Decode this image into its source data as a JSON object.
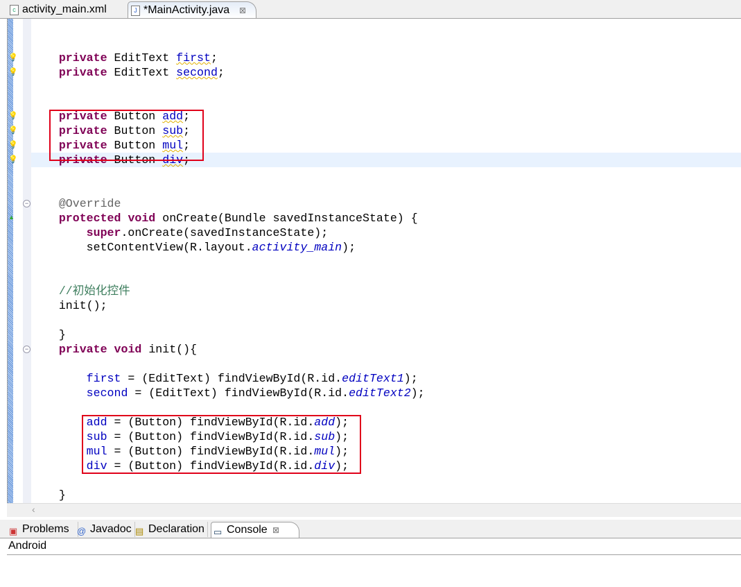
{
  "tabs": [
    {
      "label": "activity_main.xml",
      "icon": "xml-file-icon"
    },
    {
      "label": "*MainActivity.java",
      "icon": "java-file-icon",
      "active": true
    }
  ],
  "code": [
    [],
    [
      [
        "    "
      ],
      [
        "private",
        "kw"
      ],
      [
        " EditText "
      ],
      [
        "first",
        "fld warn"
      ],
      [
        ";"
      ]
    ],
    [
      [
        "    "
      ],
      [
        "private",
        "kw"
      ],
      [
        " EditText "
      ],
      [
        "second",
        "fld warn"
      ],
      [
        ";"
      ]
    ],
    [],
    [],
    [
      [
        "    "
      ],
      [
        "private",
        "kw"
      ],
      [
        " Button "
      ],
      [
        "add",
        "fld warn"
      ],
      [
        ";"
      ]
    ],
    [
      [
        "    "
      ],
      [
        "private",
        "kw"
      ],
      [
        " Button "
      ],
      [
        "sub",
        "fld warn"
      ],
      [
        ";"
      ]
    ],
    [
      [
        "    "
      ],
      [
        "private",
        "kw"
      ],
      [
        " Button "
      ],
      [
        "mul",
        "fld warn"
      ],
      [
        ";"
      ]
    ],
    [
      [
        "    "
      ],
      [
        "private",
        "kw"
      ],
      [
        " Button "
      ],
      [
        "div",
        "fld warn"
      ],
      [
        ";"
      ]
    ],
    [],
    [],
    [
      [
        "    "
      ],
      [
        "@Override",
        "ann"
      ]
    ],
    [
      [
        "    "
      ],
      [
        "protected",
        "kw"
      ],
      [
        " "
      ],
      [
        "void",
        "kw"
      ],
      [
        " onCreate(Bundle savedInstanceState) {"
      ]
    ],
    [
      [
        "        "
      ],
      [
        "super",
        "kw"
      ],
      [
        ".onCreate(savedInstanceState);"
      ]
    ],
    [
      [
        "        setContentView(R.layout."
      ],
      [
        "activity_main",
        "stat"
      ],
      [
        ");"
      ]
    ],
    [],
    [],
    [
      [
        "    "
      ],
      [
        "//初始化控件",
        "cmt"
      ]
    ],
    [
      [
        "    init();"
      ]
    ],
    [],
    [
      [
        "    }"
      ]
    ],
    [
      [
        "    "
      ],
      [
        "private",
        "kw"
      ],
      [
        " "
      ],
      [
        "void",
        "kw"
      ],
      [
        " init(){"
      ]
    ],
    [],
    [
      [
        "        "
      ],
      [
        "first",
        "fld"
      ],
      [
        " = (EditText) findViewById(R.id."
      ],
      [
        "editText1",
        "stat"
      ],
      [
        ");"
      ]
    ],
    [
      [
        "        "
      ],
      [
        "second",
        "fld"
      ],
      [
        " = (EditText) findViewById(R.id."
      ],
      [
        "editText2",
        "stat"
      ],
      [
        ");"
      ]
    ],
    [],
    [
      [
        "        "
      ],
      [
        "add",
        "fld"
      ],
      [
        " = (Button) findViewById(R.id."
      ],
      [
        "add",
        "stat"
      ],
      [
        ");"
      ]
    ],
    [
      [
        "        "
      ],
      [
        "sub",
        "fld"
      ],
      [
        " = (Button) findViewById(R.id."
      ],
      [
        "sub",
        "stat"
      ],
      [
        ");"
      ]
    ],
    [
      [
        "        "
      ],
      [
        "mul",
        "fld"
      ],
      [
        " = (Button) findViewById(R.id."
      ],
      [
        "mul",
        "stat"
      ],
      [
        ");"
      ]
    ],
    [
      [
        "        "
      ],
      [
        "div",
        "fld"
      ],
      [
        " = (Button) findViewById(R.id."
      ],
      [
        "div",
        "stat"
      ],
      [
        ");"
      ]
    ],
    [],
    [
      [
        "    }"
      ]
    ]
  ],
  "warning_lines": [
    1,
    2,
    5,
    6,
    7,
    8
  ],
  "fold_lines": [
    11,
    21
  ],
  "override_line": 12,
  "panel_tabs": [
    {
      "label": "Problems",
      "icon": "problems-icon"
    },
    {
      "label": "Javadoc",
      "icon": "at-icon"
    },
    {
      "label": "Declaration",
      "icon": "declaration-icon"
    },
    {
      "label": "Console",
      "icon": "console-icon",
      "active": true
    }
  ],
  "console_label": "Android",
  "colors": {
    "highlight_box": "#e0001a",
    "keyword": "#7f0055",
    "field": "#0000c0",
    "comment": "#3f7f5f"
  }
}
